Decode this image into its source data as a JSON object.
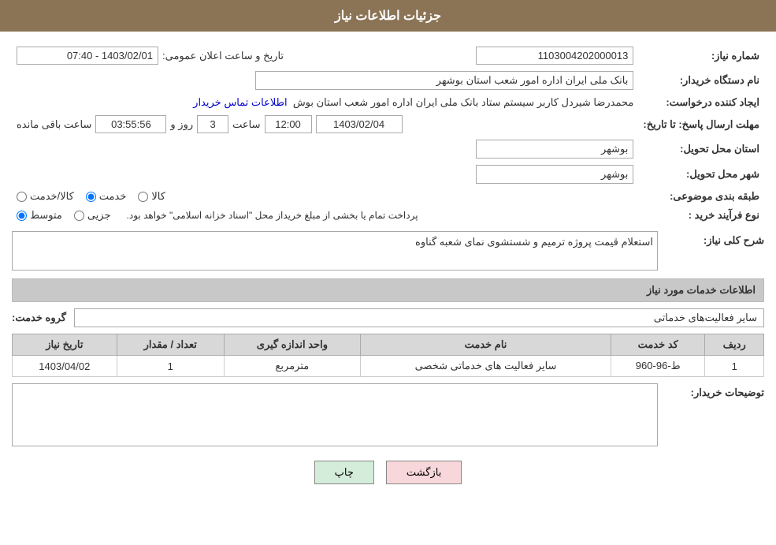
{
  "header": {
    "title": "جزئیات اطلاعات نیاز"
  },
  "fields": {
    "need_number_label": "شماره نیاز:",
    "need_number_value": "1103004202000013",
    "buyer_org_label": "نام دستگاه خریدار:",
    "buyer_org_value": "بانک ملی ایران اداره امور شعب استان بوشهر",
    "creator_label": "ایجاد کننده درخواست:",
    "creator_value": "محمدرضا شیردل کاربر سیستم ستاد بانک ملی ایران اداره امور شعب استان بوش",
    "contact_link": "اطلاعات تماس خریدار",
    "response_deadline_label": "مهلت ارسال پاسخ: تا تاریخ:",
    "response_date": "1403/02/04",
    "response_time": "12:00",
    "response_day": "3",
    "response_remaining": "03:55:56",
    "announce_label": "تاریخ و ساعت اعلان عمومی:",
    "announce_value": "1403/02/01 - 07:40",
    "province_label": "استان محل تحویل:",
    "province_value": "بوشهر",
    "city_label": "شهر محل تحویل:",
    "city_value": "بوشهر",
    "category_label": "طبقه بندی موضوعی:",
    "category_options": [
      {
        "label": "کالا",
        "value": "kala"
      },
      {
        "label": "خدمت",
        "value": "khadamat"
      },
      {
        "label": "کالا/خدمت",
        "value": "kala_khadamat"
      }
    ],
    "category_selected": "khadamat",
    "purchase_type_label": "نوع فرآیند خرید :",
    "purchase_options": [
      {
        "label": "جزیی",
        "value": "jozi"
      },
      {
        "label": "متوسط",
        "value": "motavasset"
      }
    ],
    "purchase_selected": "motavasset",
    "purchase_note": "پرداخت تمام یا بخشی از مبلغ خریداز محل \"اسناد خزانه اسلامی\" خواهد بود.",
    "description_label": "شرح کلی نیاز:",
    "description_value": "استعلام قیمت پروژه ترمیم و شستشوی نمای شعبه گناوه"
  },
  "services_section": {
    "title": "اطلاعات خدمات مورد نیاز",
    "group_label": "گروه خدمت:",
    "group_value": "سایر فعالیت‌های خدماتی",
    "table": {
      "headers": [
        "ردیف",
        "کد خدمت",
        "نام خدمت",
        "واحد اندازه گیری",
        "تعداد / مقدار",
        "تاریخ نیاز"
      ],
      "rows": [
        {
          "row": "1",
          "code": "ط-96-960",
          "name": "سایر فعالیت های خدماتی شخصی",
          "unit": "مترمربع",
          "count": "1",
          "date": "1403/04/02"
        }
      ]
    }
  },
  "buyer_notes_label": "توضیحات خریدار:",
  "buyer_notes_value": "",
  "buttons": {
    "print": "چاپ",
    "back": "بازگشت"
  }
}
